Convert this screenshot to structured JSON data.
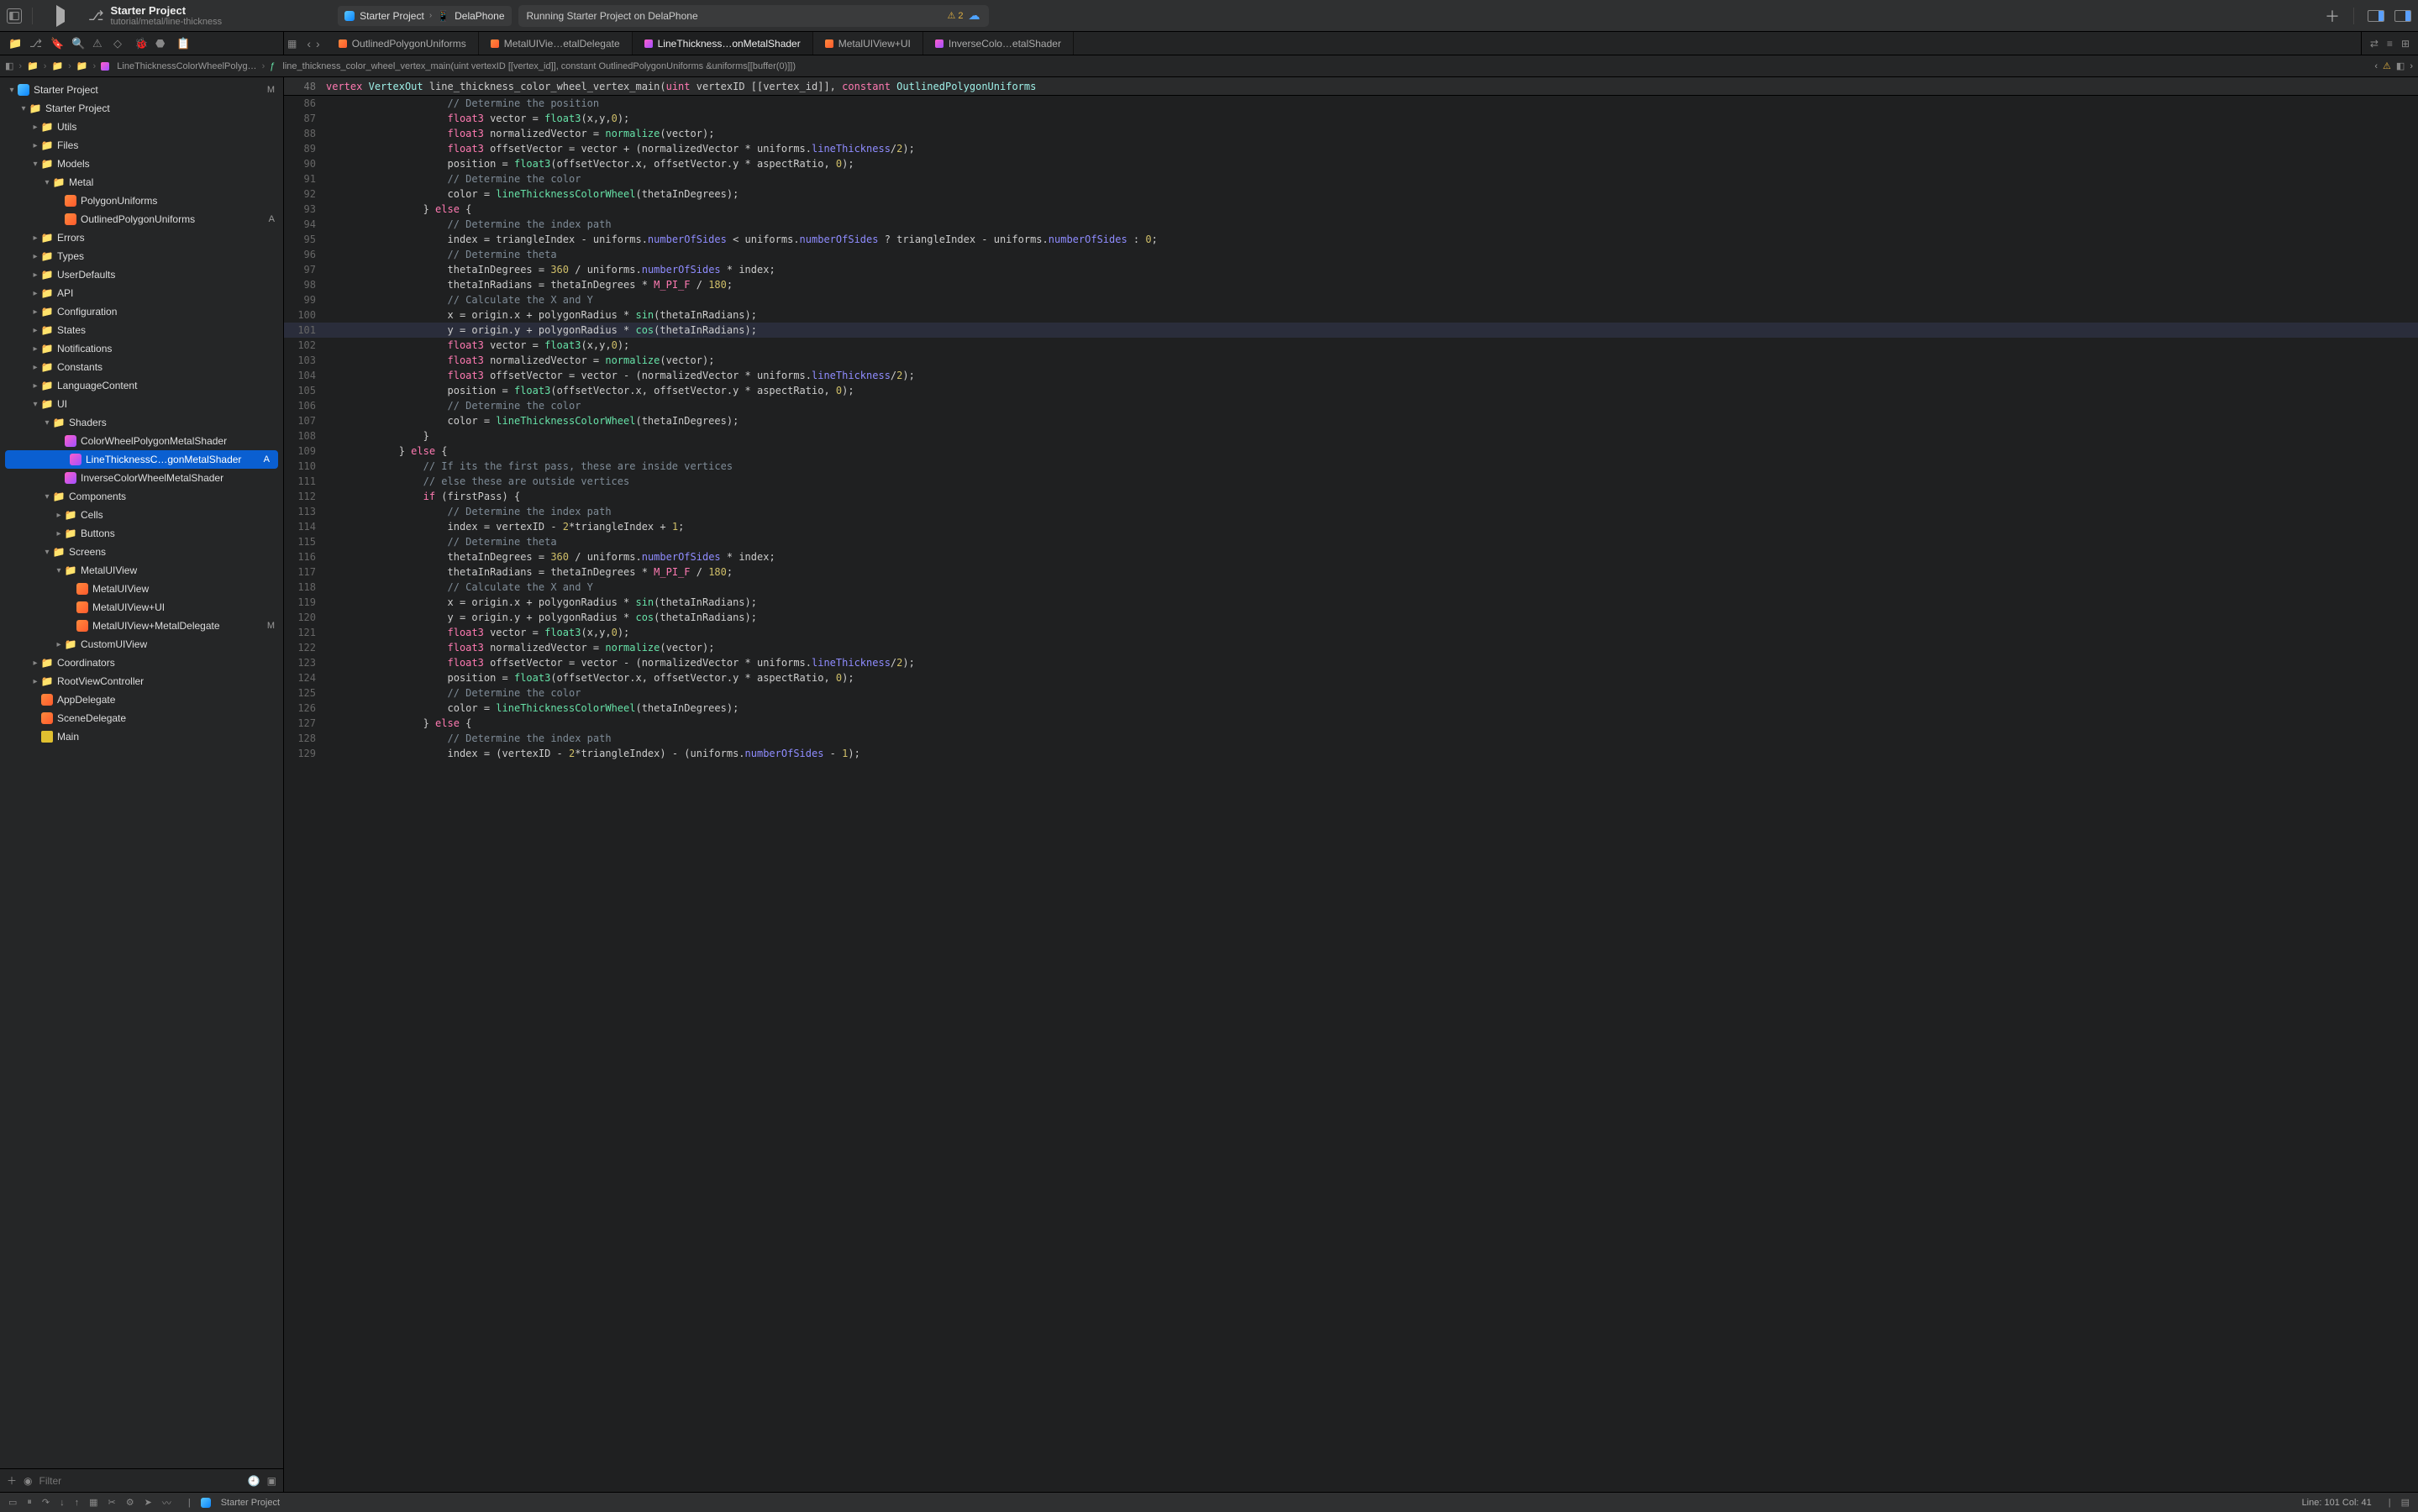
{
  "project": {
    "name": "Starter Project",
    "subtitle": "tutorial/metal/line-thickness"
  },
  "scheme": {
    "app_icon": "app",
    "target": "Starter Project",
    "device_icon": "iphone",
    "device": "DelaPhone"
  },
  "status": {
    "text": "Running Starter Project on DelaPhone",
    "warnings": "2"
  },
  "navigator_icons": [
    "folder",
    "scm",
    "bookmark",
    "search",
    "issue",
    "test",
    "debug",
    "breakpoint",
    "report"
  ],
  "tabs": [
    {
      "icon": "swift",
      "label": "OutlinedPolygonUniforms",
      "active": false
    },
    {
      "icon": "swift",
      "label": "MetalUIVie…etalDelegate",
      "active": false
    },
    {
      "icon": "metal",
      "label": "LineThickness…onMetalShader",
      "active": true
    },
    {
      "icon": "swift",
      "label": "MetalUIView+UI",
      "active": false
    },
    {
      "icon": "metal",
      "label": "InverseColo…etalShader",
      "active": false
    }
  ],
  "breadcrumb": [
    "Starter Project",
    "LineThicknessColorWheelPolyg…",
    "line_thickness_color_wheel_vertex_main(uint vertexID [[vertex_id]], constant OutlinedPolygonUniforms &uniforms[[buffer(0)]])"
  ],
  "sticky_line": {
    "num": "48",
    "tokens": [
      {
        "c": "kw",
        "t": "vertex"
      },
      {
        "c": "",
        "t": " "
      },
      {
        "c": "type",
        "t": "VertexOut"
      },
      {
        "c": "",
        "t": " line_thickness_color_wheel_vertex_main("
      },
      {
        "c": "kw",
        "t": "uint"
      },
      {
        "c": "",
        "t": " vertexID [[vertex_id]], "
      },
      {
        "c": "kw",
        "t": "constant"
      },
      {
        "c": "",
        "t": " "
      },
      {
        "c": "type",
        "t": "OutlinedPolygonUniforms"
      }
    ]
  },
  "tree": [
    {
      "depth": 0,
      "d": "▾",
      "icon": "app",
      "label": "Starter Project",
      "badge": "M"
    },
    {
      "depth": 1,
      "d": "▾",
      "icon": "folder",
      "label": "Starter Project"
    },
    {
      "depth": 2,
      "d": "▸",
      "icon": "folder",
      "label": "Utils"
    },
    {
      "depth": 2,
      "d": "▸",
      "icon": "folder",
      "label": "Files"
    },
    {
      "depth": 2,
      "d": "▾",
      "icon": "folder",
      "label": "Models"
    },
    {
      "depth": 3,
      "d": "▾",
      "icon": "folder",
      "label": "Metal"
    },
    {
      "depth": 4,
      "d": "",
      "icon": "swift",
      "label": "PolygonUniforms"
    },
    {
      "depth": 4,
      "d": "",
      "icon": "swift",
      "label": "OutlinedPolygonUniforms",
      "badge": "A"
    },
    {
      "depth": 2,
      "d": "▸",
      "icon": "folder",
      "label": "Errors"
    },
    {
      "depth": 2,
      "d": "▸",
      "icon": "folder",
      "label": "Types"
    },
    {
      "depth": 2,
      "d": "▸",
      "icon": "folder",
      "label": "UserDefaults"
    },
    {
      "depth": 2,
      "d": "▸",
      "icon": "folder",
      "label": "API"
    },
    {
      "depth": 2,
      "d": "▸",
      "icon": "folder",
      "label": "Configuration"
    },
    {
      "depth": 2,
      "d": "▸",
      "icon": "folder",
      "label": "States"
    },
    {
      "depth": 2,
      "d": "▸",
      "icon": "folder",
      "label": "Notifications"
    },
    {
      "depth": 2,
      "d": "▸",
      "icon": "folder",
      "label": "Constants"
    },
    {
      "depth": 2,
      "d": "▸",
      "icon": "folder",
      "label": "LanguageContent"
    },
    {
      "depth": 2,
      "d": "▾",
      "icon": "folder",
      "label": "UI"
    },
    {
      "depth": 3,
      "d": "▾",
      "icon": "folder",
      "label": "Shaders"
    },
    {
      "depth": 4,
      "d": "",
      "icon": "metal",
      "label": "ColorWheelPolygonMetalShader"
    },
    {
      "depth": 4,
      "d": "",
      "icon": "metal",
      "label": "LineThicknessC…gonMetalShader",
      "badge": "A",
      "selected": true
    },
    {
      "depth": 4,
      "d": "",
      "icon": "metal",
      "label": "InverseColorWheelMetalShader"
    },
    {
      "depth": 3,
      "d": "▾",
      "icon": "folder",
      "label": "Components"
    },
    {
      "depth": 4,
      "d": "▸",
      "icon": "folder",
      "label": "Cells"
    },
    {
      "depth": 4,
      "d": "▸",
      "icon": "folder",
      "label": "Buttons"
    },
    {
      "depth": 3,
      "d": "▾",
      "icon": "folder",
      "label": "Screens"
    },
    {
      "depth": 4,
      "d": "▾",
      "icon": "folder",
      "label": "MetalUIView"
    },
    {
      "depth": 5,
      "d": "",
      "icon": "swift",
      "label": "MetalUIView"
    },
    {
      "depth": 5,
      "d": "",
      "icon": "swift",
      "label": "MetalUIView+UI"
    },
    {
      "depth": 5,
      "d": "",
      "icon": "swift",
      "label": "MetalUIView+MetalDelegate",
      "badge": "M"
    },
    {
      "depth": 4,
      "d": "▸",
      "icon": "folder",
      "label": "CustomUIView"
    },
    {
      "depth": 2,
      "d": "▸",
      "icon": "folder",
      "label": "Coordinators"
    },
    {
      "depth": 2,
      "d": "▸",
      "icon": "folder",
      "label": "RootViewController"
    },
    {
      "depth": 2,
      "d": "",
      "icon": "swift",
      "label": "AppDelegate"
    },
    {
      "depth": 2,
      "d": "",
      "icon": "swift",
      "label": "SceneDelegate"
    },
    {
      "depth": 2,
      "d": "",
      "icon": "storyboard",
      "label": "Main"
    }
  ],
  "filter_placeholder": "Filter",
  "code": [
    {
      "n": 86,
      "i": 3,
      "seg": [
        {
          "c": "comment",
          "t": "// Determine the position"
        }
      ]
    },
    {
      "n": 87,
      "i": 3,
      "seg": [
        {
          "c": "kw",
          "t": "float3"
        },
        {
          "t": " vector = "
        },
        {
          "c": "func",
          "t": "float3"
        },
        {
          "t": "(x,y,"
        },
        {
          "c": "num",
          "t": "0"
        },
        {
          "t": ");"
        }
      ]
    },
    {
      "n": 88,
      "i": 3,
      "seg": [
        {
          "c": "kw",
          "t": "float3"
        },
        {
          "t": " normalizedVector = "
        },
        {
          "c": "func",
          "t": "normalize"
        },
        {
          "t": "(vector);"
        }
      ]
    },
    {
      "n": 89,
      "i": 3,
      "seg": [
        {
          "c": "kw",
          "t": "float3"
        },
        {
          "t": " offsetVector = vector + (normalizedVector * uniforms."
        },
        {
          "c": "prop",
          "t": "lineThickness"
        },
        {
          "t": "/"
        },
        {
          "c": "num",
          "t": "2"
        },
        {
          "t": ");"
        }
      ]
    },
    {
      "n": 90,
      "i": 3,
      "seg": [
        {
          "t": "position = "
        },
        {
          "c": "func",
          "t": "float3"
        },
        {
          "t": "(offsetVector.x, offsetVector.y * aspectRatio, "
        },
        {
          "c": "num",
          "t": "0"
        },
        {
          "t": ");"
        }
      ]
    },
    {
      "n": 91,
      "i": 3,
      "seg": [
        {
          "c": "comment",
          "t": "// Determine the color"
        }
      ]
    },
    {
      "n": 92,
      "i": 3,
      "seg": [
        {
          "t": "color = "
        },
        {
          "c": "func",
          "t": "lineThicknessColorWheel"
        },
        {
          "t": "(thetaInDegrees);"
        }
      ]
    },
    {
      "n": 93,
      "i": 2,
      "seg": [
        {
          "t": "} "
        },
        {
          "c": "kw",
          "t": "else"
        },
        {
          "t": " {"
        }
      ]
    },
    {
      "n": 94,
      "i": 3,
      "seg": [
        {
          "c": "comment",
          "t": "// Determine the index path"
        }
      ]
    },
    {
      "n": 95,
      "i": 3,
      "seg": [
        {
          "t": "index = triangleIndex - uniforms."
        },
        {
          "c": "prop",
          "t": "numberOfSides"
        },
        {
          "t": " < uniforms."
        },
        {
          "c": "prop",
          "t": "numberOfSides"
        },
        {
          "t": " ? triangleIndex - uniforms."
        },
        {
          "c": "prop",
          "t": "numberOfSides"
        },
        {
          "t": " : "
        },
        {
          "c": "num",
          "t": "0"
        },
        {
          "t": ";"
        }
      ]
    },
    {
      "n": 96,
      "i": 3,
      "seg": [
        {
          "c": "comment",
          "t": "// Determine theta"
        }
      ]
    },
    {
      "n": 97,
      "i": 3,
      "seg": [
        {
          "t": "thetaInDegrees = "
        },
        {
          "c": "num",
          "t": "360"
        },
        {
          "t": " / uniforms."
        },
        {
          "c": "prop",
          "t": "numberOfSides"
        },
        {
          "t": " * index;"
        }
      ]
    },
    {
      "n": 98,
      "i": 3,
      "seg": [
        {
          "t": "thetaInRadians = thetaInDegrees * "
        },
        {
          "c": "const",
          "t": "M_PI_F"
        },
        {
          "t": " / "
        },
        {
          "c": "num",
          "t": "180"
        },
        {
          "t": ";"
        }
      ]
    },
    {
      "n": 99,
      "i": 3,
      "seg": [
        {
          "c": "comment",
          "t": "// Calculate the X and Y"
        }
      ]
    },
    {
      "n": 100,
      "i": 3,
      "seg": [
        {
          "t": "x = origin.x + polygonRadius * "
        },
        {
          "c": "func",
          "t": "sin"
        },
        {
          "t": "(thetaInRadians);"
        }
      ]
    },
    {
      "n": 101,
      "i": 3,
      "hl": true,
      "seg": [
        {
          "t": "y = origin.y + polygonRadius * "
        },
        {
          "c": "func",
          "t": "cos"
        },
        {
          "t": "(thetaInRadians);"
        }
      ]
    },
    {
      "n": 102,
      "i": 3,
      "seg": [
        {
          "c": "kw",
          "t": "float3"
        },
        {
          "t": " vector = "
        },
        {
          "c": "func",
          "t": "float3"
        },
        {
          "t": "(x,y,"
        },
        {
          "c": "num",
          "t": "0"
        },
        {
          "t": ");"
        }
      ]
    },
    {
      "n": 103,
      "i": 3,
      "seg": [
        {
          "c": "kw",
          "t": "float3"
        },
        {
          "t": " normalizedVector = "
        },
        {
          "c": "func",
          "t": "normalize"
        },
        {
          "t": "(vector);"
        }
      ]
    },
    {
      "n": 104,
      "i": 3,
      "seg": [
        {
          "c": "kw",
          "t": "float3"
        },
        {
          "t": " offsetVector = vector - (normalizedVector * uniforms."
        },
        {
          "c": "prop",
          "t": "lineThickness"
        },
        {
          "t": "/"
        },
        {
          "c": "num",
          "t": "2"
        },
        {
          "t": ");"
        }
      ]
    },
    {
      "n": 105,
      "i": 3,
      "seg": [
        {
          "t": "position = "
        },
        {
          "c": "func",
          "t": "float3"
        },
        {
          "t": "(offsetVector.x, offsetVector.y * aspectRatio, "
        },
        {
          "c": "num",
          "t": "0"
        },
        {
          "t": ");"
        }
      ]
    },
    {
      "n": 106,
      "i": 3,
      "seg": [
        {
          "c": "comment",
          "t": "// Determine the color"
        }
      ]
    },
    {
      "n": 107,
      "i": 3,
      "seg": [
        {
          "t": "color = "
        },
        {
          "c": "func",
          "t": "lineThicknessColorWheel"
        },
        {
          "t": "(thetaInDegrees);"
        }
      ]
    },
    {
      "n": 108,
      "i": 2,
      "seg": [
        {
          "t": "}"
        }
      ]
    },
    {
      "n": 109,
      "i": 1,
      "seg": [
        {
          "t": "} "
        },
        {
          "c": "kw",
          "t": "else"
        },
        {
          "t": " {"
        }
      ]
    },
    {
      "n": 110,
      "i": 2,
      "seg": [
        {
          "c": "comment",
          "t": "// If its the first pass, these are inside vertices"
        }
      ]
    },
    {
      "n": 111,
      "i": 2,
      "seg": [
        {
          "c": "comment",
          "t": "// else these are outside vertices"
        }
      ]
    },
    {
      "n": 112,
      "i": 2,
      "seg": [
        {
          "c": "kw",
          "t": "if"
        },
        {
          "t": " (firstPass) {"
        }
      ]
    },
    {
      "n": 113,
      "i": 3,
      "seg": [
        {
          "c": "comment",
          "t": "// Determine the index path"
        }
      ]
    },
    {
      "n": 114,
      "i": 3,
      "seg": [
        {
          "t": "index = vertexID - "
        },
        {
          "c": "num",
          "t": "2"
        },
        {
          "t": "*triangleIndex + "
        },
        {
          "c": "num",
          "t": "1"
        },
        {
          "t": ";"
        }
      ]
    },
    {
      "n": 115,
      "i": 3,
      "seg": [
        {
          "c": "comment",
          "t": "// Determine theta"
        }
      ]
    },
    {
      "n": 116,
      "i": 3,
      "seg": [
        {
          "t": "thetaInDegrees = "
        },
        {
          "c": "num",
          "t": "360"
        },
        {
          "t": " / uniforms."
        },
        {
          "c": "prop",
          "t": "numberOfSides"
        },
        {
          "t": " * index;"
        }
      ]
    },
    {
      "n": 117,
      "i": 3,
      "seg": [
        {
          "t": "thetaInRadians = thetaInDegrees * "
        },
        {
          "c": "const",
          "t": "M_PI_F"
        },
        {
          "t": " / "
        },
        {
          "c": "num",
          "t": "180"
        },
        {
          "t": ";"
        }
      ]
    },
    {
      "n": 118,
      "i": 3,
      "seg": [
        {
          "c": "comment",
          "t": "// Calculate the X and Y"
        }
      ]
    },
    {
      "n": 119,
      "i": 3,
      "seg": [
        {
          "t": "x = origin.x + polygonRadius * "
        },
        {
          "c": "func",
          "t": "sin"
        },
        {
          "t": "(thetaInRadians);"
        }
      ]
    },
    {
      "n": 120,
      "i": 3,
      "seg": [
        {
          "t": "y = origin.y + polygonRadius * "
        },
        {
          "c": "func",
          "t": "cos"
        },
        {
          "t": "(thetaInRadians);"
        }
      ]
    },
    {
      "n": 121,
      "i": 3,
      "seg": [
        {
          "c": "kw",
          "t": "float3"
        },
        {
          "t": " vector = "
        },
        {
          "c": "func",
          "t": "float3"
        },
        {
          "t": "(x,y,"
        },
        {
          "c": "num",
          "t": "0"
        },
        {
          "t": ");"
        }
      ]
    },
    {
      "n": 122,
      "i": 3,
      "seg": [
        {
          "c": "kw",
          "t": "float3"
        },
        {
          "t": " normalizedVector = "
        },
        {
          "c": "func",
          "t": "normalize"
        },
        {
          "t": "(vector);"
        }
      ]
    },
    {
      "n": 123,
      "i": 3,
      "seg": [
        {
          "c": "kw",
          "t": "float3"
        },
        {
          "t": " offsetVector = vector - (normalizedVector * uniforms."
        },
        {
          "c": "prop",
          "t": "lineThickness"
        },
        {
          "t": "/"
        },
        {
          "c": "num",
          "t": "2"
        },
        {
          "t": ");"
        }
      ]
    },
    {
      "n": 124,
      "i": 3,
      "seg": [
        {
          "t": "position = "
        },
        {
          "c": "func",
          "t": "float3"
        },
        {
          "t": "(offsetVector.x, offsetVector.y * aspectRatio, "
        },
        {
          "c": "num",
          "t": "0"
        },
        {
          "t": ");"
        }
      ]
    },
    {
      "n": 125,
      "i": 3,
      "seg": [
        {
          "c": "comment",
          "t": "// Determine the color"
        }
      ]
    },
    {
      "n": 126,
      "i": 3,
      "seg": [
        {
          "t": "color = "
        },
        {
          "c": "func",
          "t": "lineThicknessColorWheel"
        },
        {
          "t": "(thetaInDegrees);"
        }
      ]
    },
    {
      "n": 127,
      "i": 2,
      "seg": [
        {
          "t": "} "
        },
        {
          "c": "kw",
          "t": "else"
        },
        {
          "t": " {"
        }
      ]
    },
    {
      "n": 128,
      "i": 3,
      "seg": [
        {
          "c": "comment",
          "t": "// Determine the index path"
        }
      ]
    },
    {
      "n": 129,
      "i": 3,
      "seg": [
        {
          "t": "index = (vertexID - "
        },
        {
          "c": "num",
          "t": "2"
        },
        {
          "t": "*triangleIndex) - (uniforms."
        },
        {
          "c": "prop",
          "t": "numberOfSides"
        },
        {
          "t": " - "
        },
        {
          "c": "num",
          "t": "1"
        },
        {
          "t": ");"
        }
      ]
    }
  ],
  "statusbar": {
    "target": "Starter Project",
    "cursor": "Line: 101  Col: 41"
  }
}
